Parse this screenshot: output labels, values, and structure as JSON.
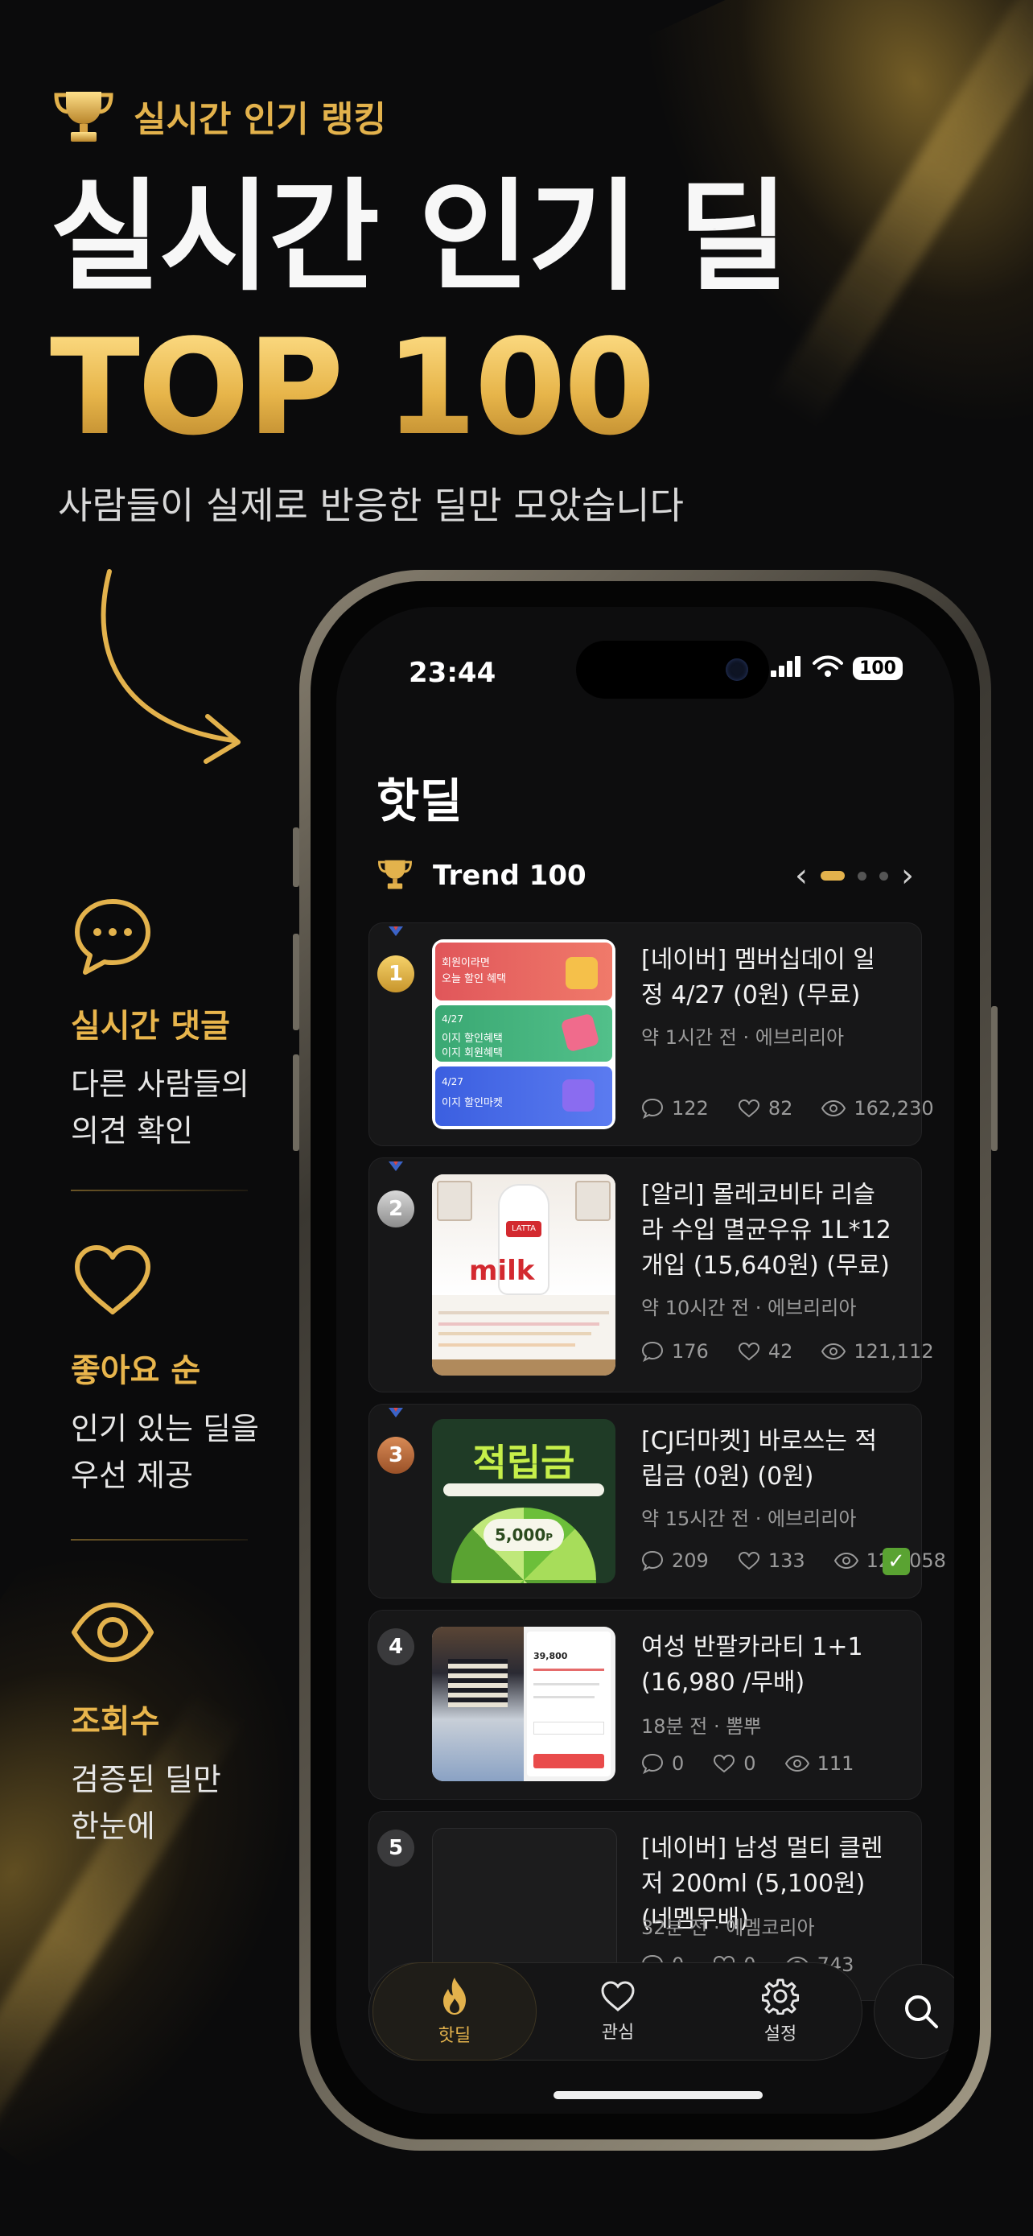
{
  "hero": {
    "kicker": "실시간 인기 랭킹",
    "title": "실시간 인기 딜",
    "highlight": "TOP 100",
    "subtitle": "사람들이 실제로 반응한 딜만 모았습니다"
  },
  "features": [
    {
      "icon": "chat-bubble-icon",
      "title": "실시간 댓글",
      "desc": "다른 사람들의\n의견 확인"
    },
    {
      "icon": "heart-icon",
      "title": "좋아요 순",
      "desc": "인기 있는 딜을\n우선 제공"
    },
    {
      "icon": "eye-icon",
      "title": "조회수",
      "desc": "검증된 딜만\n한눈에"
    }
  ],
  "status": {
    "time": "23:44",
    "battery": "100"
  },
  "page": {
    "title": "핫딜",
    "trend_label": "Trend 100"
  },
  "deals": [
    {
      "rank": "1",
      "title": "[네이버] 멤버십데이 일정 4/27 (0원) (무료)",
      "meta": "약 1시간 전 · 에브리리아",
      "comments": "122",
      "likes": "82",
      "views": "162,230",
      "thumb_lines": [
        "4/27",
        "회원이라면",
        "오늘 할인 혜택",
        "4/27",
        "이지 할인혜택",
        "이지 회원혜택",
        "4/27",
        "이지 할인마켓"
      ]
    },
    {
      "rank": "2",
      "title": "[알리] 몰레코비타 리슬라 수입 멸균우유 1L*12개입 (15,640원) (무료)",
      "meta": "약 10시간 전 · 에브리리아",
      "comments": "176",
      "likes": "42",
      "views": "121,112",
      "thumb_lines": [
        "milk",
        "LATTA"
      ]
    },
    {
      "rank": "3",
      "title": "[CJ더마켓] 바로쓰는 적립금 (0원) (0원)",
      "meta": "약 15시간 전 · 에브리리아",
      "comments": "209",
      "likes": "133",
      "views": "129,058",
      "thumb_lines": [
        "적립금",
        "5,000",
        "P"
      ]
    },
    {
      "rank": "4",
      "title": "여성 반팔카라티 1+1 (16,980 /무배)",
      "meta": "18분 전 · 뽐뿌",
      "comments": "0",
      "likes": "0",
      "views": "111",
      "thumb_lines": [
        "39,800"
      ]
    },
    {
      "rank": "5",
      "title": "[네이버] 남성 멀티 클렌저 200ml (5,100원) (네멤무배)",
      "meta": "32분 전 · 에멤코리아",
      "comments": "0",
      "likes": "0",
      "views": "743",
      "thumb_lines": []
    }
  ],
  "tabs": [
    {
      "icon": "fire-icon",
      "label": "핫딜"
    },
    {
      "icon": "heart-icon",
      "label": "관심"
    },
    {
      "icon": "gear-icon",
      "label": "설정"
    }
  ],
  "colors": {
    "gold": "#e3b24c",
    "background": "#0b0b0c",
    "card": "#171718",
    "check": "#5aa332"
  }
}
